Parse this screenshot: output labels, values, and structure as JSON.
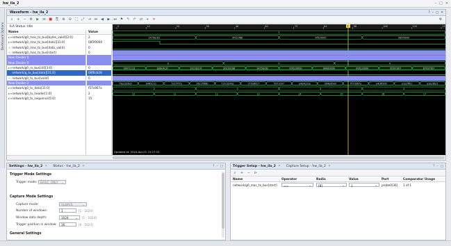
{
  "window": {
    "title": "hw_ila_2",
    "controls": [
      "–",
      "□",
      "✕"
    ]
  },
  "sidebar": {
    "label": "Dashboard Options"
  },
  "waveform": {
    "title": "Waveform - hw_ila_2",
    "header_controls": [
      "?",
      "–",
      "□",
      "✕"
    ],
    "status": "ILA Status: Idle",
    "columns": {
      "name": "Name",
      "value": "Value"
    },
    "rows": [
      {
        "name": "network/g0_mac_tx_bus[bytes_valid][2:0]",
        "value": "2",
        "kind": "bus"
      },
      {
        "name": "network/g0_mac_tx_bus[data][31:0]",
        "value": "085f0000",
        "kind": "bus"
      },
      {
        "name": "network/g0_mac_tx_bus[data_valid]",
        "value": "0",
        "kind": "bit"
      },
      {
        "name": "network/g0_mac_tx_bus[start]",
        "value": "0",
        "kind": "bit"
      },
      {
        "name": "New Divider 0",
        "value": "",
        "kind": "divider"
      },
      {
        "name": "New Divider 0",
        "value": "",
        "kind": "divider"
      },
      {
        "name": "network/g0_rx_bus[ctl][3:0]",
        "value": "0",
        "kind": "bus"
      },
      {
        "name": "network/g_tx_bus[data][31:0]",
        "value": "00f0cb28",
        "kind": "bus",
        "selected": true
      },
      {
        "name": "network/g0_tx_bus[valid]",
        "value": "0",
        "kind": "bit"
      },
      {
        "name": "New Divider 2",
        "value": "",
        "kind": "divider"
      },
      {
        "name": "network/g0_tx_data[31:0]",
        "value": "f57c867a",
        "kind": "bus"
      },
      {
        "name": "network/g0_tx_header[1:0]",
        "value": "2",
        "kind": "bus"
      },
      {
        "name": "network/g0_tx_sequence[5:0]",
        "value": "15",
        "kind": "bus"
      }
    ],
    "timeline_labels": [
      "0",
      "12",
      "24",
      "36",
      "48",
      "60",
      "72",
      "84",
      "96",
      "108",
      "120",
      "132"
    ],
    "cursor_label": "T",
    "updated": "Updated at: 2024-Apr-01 15:27:53",
    "bus_values": {
      "r0": [
        "2"
      ],
      "r1": [
        "1475bc62",
        "0f0c2f88",
        "9f5c0000",
        "085f0000"
      ],
      "r6": [
        "0",
        "0",
        "0"
      ],
      "r7": [
        "0007cc13",
        "b06c4c2f",
        "32c2b1c4",
        "30c2b168",
        "1475bc62",
        "00f1c0000",
        "00000000",
        "00f1c0000",
        "2f397d07",
        "87097f07"
      ],
      "r10": [
        "73ecdc6e0",
        "b485c10",
        "5c1f7f7b",
        "26c1f5f8b",
        "f17cd24bc",
        "177a6017",
        "597c097",
        "e4e4e2ea",
        "dd4ed0a4",
        "f57c867a",
        "e4c6f200",
        "e1e2ff01",
        "a3ec8bc1"
      ],
      "r11": [
        "2",
        "3",
        "2",
        "3"
      ],
      "r12": [
        "10",
        "11",
        "12",
        "13",
        "14",
        "15",
        "16",
        "17"
      ]
    }
  },
  "settings_panel": {
    "tabs": [
      {
        "label": "Settings - hw_ila_2",
        "active": true
      },
      {
        "label": "Status - hw_ila_2",
        "active": false
      }
    ],
    "trigger_mode_settings": "Trigger Mode Settings",
    "trigger_mode_label": "Trigger mode:",
    "trigger_mode_value": "BASIC_ONLY",
    "capture_mode_settings": "Capture Mode Settings",
    "capture_mode_label": "Capture mode:",
    "capture_mode_value": "ALWAYS",
    "num_windows_label": "Number of windows:",
    "num_windows_value": "1",
    "num_windows_range": "[1 - 1024]",
    "window_depth_label": "Window data depth:",
    "window_depth_value": "1024",
    "window_depth_range": "[1 - 1024]",
    "trigger_pos_label": "Trigger position in window:",
    "trigger_pos_value": "16",
    "trigger_pos_range": "[0 - 1023]",
    "general_settings": "General Settings"
  },
  "trigger_panel": {
    "tabs": [
      {
        "label": "Trigger Setup - hw_ila_2",
        "active": true
      },
      {
        "label": "Capture Setup - hw_ila_2",
        "active": false
      }
    ],
    "columns": [
      "Name",
      "Operator",
      "Radix",
      "Value",
      "Port",
      "Comparator Usage"
    ],
    "rows": [
      {
        "name": "network/g0_mac_tx_bus[start]",
        "operator": "==",
        "radix": "[B]",
        "value": "1",
        "port": "probe0[36]",
        "usage": "1 of 1"
      }
    ]
  }
}
